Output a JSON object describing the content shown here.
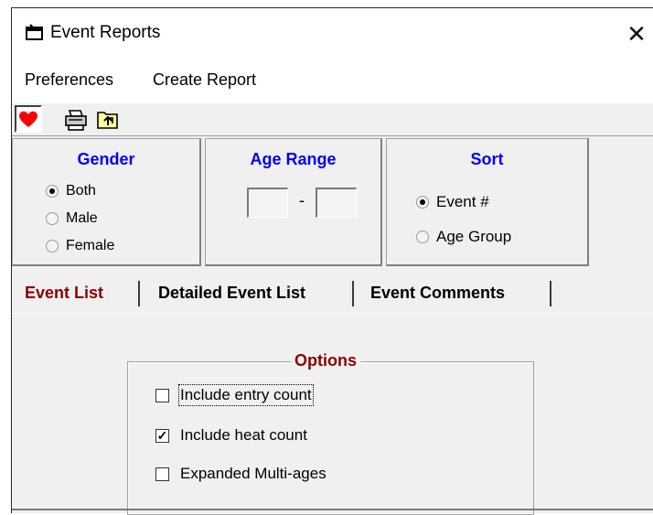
{
  "window": {
    "title": "Event Reports",
    "close_glyph": "✕"
  },
  "menu": {
    "items": [
      "Preferences",
      "Create Report"
    ]
  },
  "toolbar": {
    "icons": [
      "heart-icon",
      "printer-icon",
      "folder-up-icon"
    ],
    "heart_color": "#ff0000"
  },
  "gender": {
    "title": "Gender",
    "options": [
      "Both",
      "Male",
      "Female"
    ],
    "selected": "Both"
  },
  "age_range": {
    "title": "Age Range",
    "from": "",
    "separator": "-",
    "to": ""
  },
  "sort": {
    "title": "Sort",
    "options": [
      "Event #",
      "Age Group"
    ],
    "selected": "Event #"
  },
  "tabs": {
    "items": [
      "Event List",
      "Detailed Event List",
      "Event Comments"
    ],
    "active": "Event List",
    "active_color": "#8b0000"
  },
  "options": {
    "title": "Options",
    "checkboxes": [
      {
        "label": "Include entry count",
        "checked": false
      },
      {
        "label": "Include heat count",
        "checked": true
      },
      {
        "label": "Expanded Multi-ages",
        "checked": false
      }
    ]
  }
}
